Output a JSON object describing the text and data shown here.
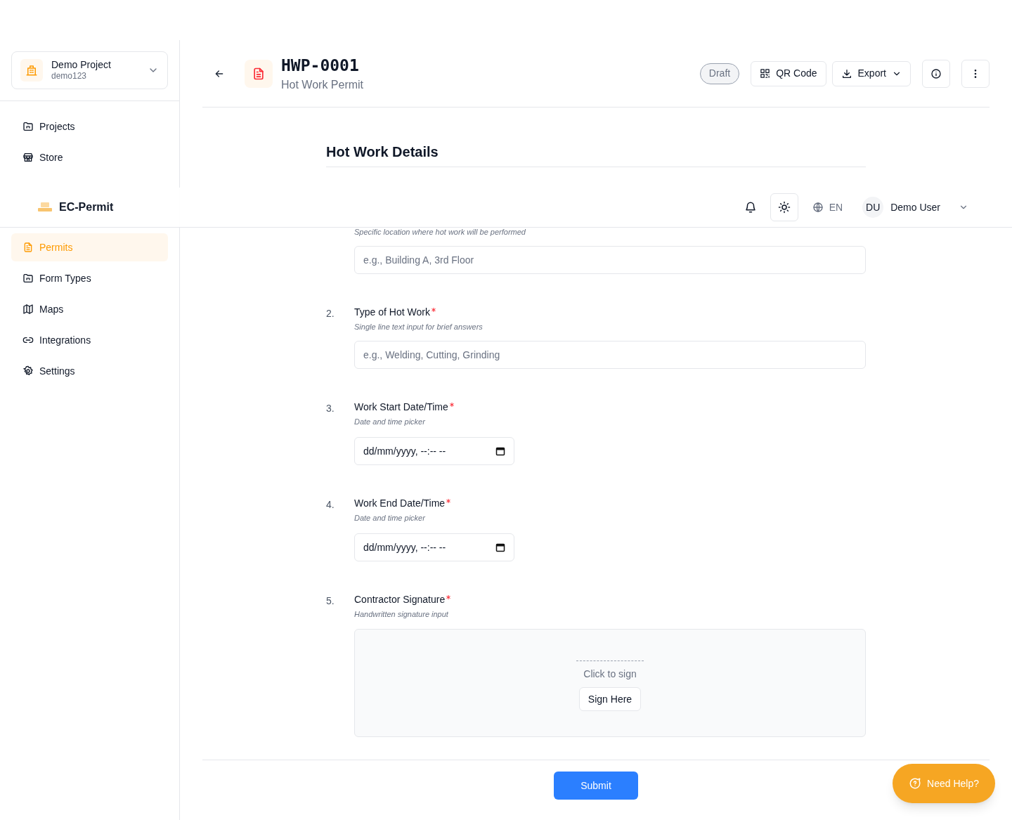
{
  "project_switcher": {
    "name": "Demo Project",
    "code": "demo123"
  },
  "sidebar": {
    "top_items": [
      {
        "label": "Projects",
        "selected": false
      },
      {
        "label": "Store",
        "selected": false
      }
    ],
    "items": [
      {
        "label": "Permits",
        "selected": true
      },
      {
        "label": "Form Types",
        "selected": false
      },
      {
        "label": "Maps",
        "selected": false
      },
      {
        "label": "Integrations",
        "selected": false
      },
      {
        "label": "Settings",
        "selected": false
      }
    ]
  },
  "permit_header": {
    "title": "HWP-0001",
    "subtitle": "Hot Work Permit",
    "status": "Draft",
    "qr_button": "QR Code",
    "export_button": "Export"
  },
  "top_bar": {
    "app_name": "EC-Permit",
    "language": "EN",
    "user_initials": "DU",
    "user_name": "Demo User"
  },
  "form": {
    "section_title": "Hot Work Details",
    "fields": [
      {
        "kind": "text",
        "description": "Specific location where hot work will be performed",
        "placeholder": "e.g., Building A, 3rd Floor"
      },
      {
        "kind": "text",
        "number": "2.",
        "label": "Type of Hot Work",
        "required": true,
        "description": "Single line text input for brief answers",
        "placeholder": "e.g., Welding, Cutting, Grinding"
      },
      {
        "kind": "datetime",
        "number": "3.",
        "label": "Work Start Date/Time",
        "required": true,
        "description": "Date and time picker",
        "placeholder": "dd/mm/yyyy, --:-- --"
      },
      {
        "kind": "datetime",
        "number": "4.",
        "label": "Work End Date/Time",
        "required": true,
        "description": "Date and time picker",
        "placeholder": "dd/mm/yyyy, --:-- --"
      },
      {
        "kind": "signature",
        "number": "5.",
        "label": "Contractor Signature",
        "required": true,
        "description": "Handwritten signature input",
        "prompt": "Click to sign",
        "button": "Sign Here"
      }
    ]
  },
  "submit_button": "Submit",
  "help_button": "Need Help?"
}
